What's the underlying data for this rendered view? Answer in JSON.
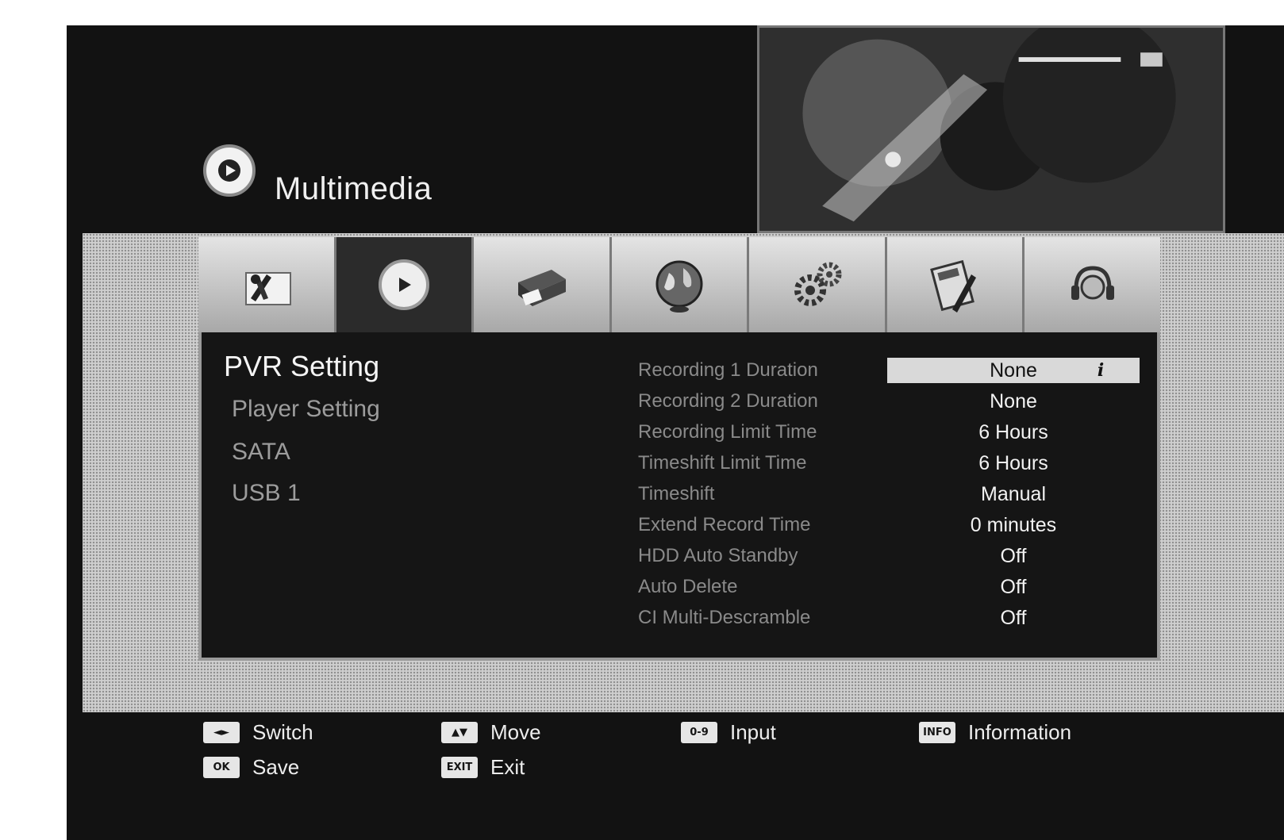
{
  "header": {
    "title": "Multimedia",
    "logo_icon": "play-icon"
  },
  "tabs": [
    {
      "icon": "tools-icon",
      "active": false
    },
    {
      "icon": "multimedia-play-icon",
      "active": true
    },
    {
      "icon": "printer-icon",
      "active": false
    },
    {
      "icon": "globe-icon",
      "active": false
    },
    {
      "icon": "gears-icon",
      "active": false
    },
    {
      "icon": "calculator-pencil-icon",
      "active": false
    },
    {
      "icon": "headset-icon",
      "active": false
    }
  ],
  "menu": {
    "items": [
      {
        "label": "PVR Setting"
      },
      {
        "label": "Player Setting"
      },
      {
        "label": "SATA"
      },
      {
        "label": "USB 1"
      }
    ],
    "selected": "PVR Setting"
  },
  "settings": [
    {
      "label": "Recording 1 Duration",
      "value": "None"
    },
    {
      "label": "Recording 2 Duration",
      "value": "None"
    },
    {
      "label": "Recording Limit Time",
      "value": "6 Hours"
    },
    {
      "label": "Timeshift Limit Time",
      "value": "6 Hours"
    },
    {
      "label": "Timeshift",
      "value": "Manual"
    },
    {
      "label": "Extend Record Time",
      "value": "0 minutes"
    },
    {
      "label": "HDD Auto Standby",
      "value": "Off"
    },
    {
      "label": "Auto Delete",
      "value": "Off"
    },
    {
      "label": "CI Multi-Descramble",
      "value": "Off"
    }
  ],
  "footer": {
    "hints": [
      {
        "key": "◄►",
        "label": "Switch"
      },
      {
        "key": "▲▼",
        "label": "Move"
      },
      {
        "key": "0-9",
        "label": "Input"
      },
      {
        "key": "INFO",
        "label": "Information"
      },
      {
        "key": "OK",
        "label": "Save"
      },
      {
        "key": "EXIT",
        "label": "Exit"
      }
    ]
  },
  "colors": {
    "background": "#121212",
    "highlight": "#d9d9d9",
    "text": "#f2f2f2"
  }
}
